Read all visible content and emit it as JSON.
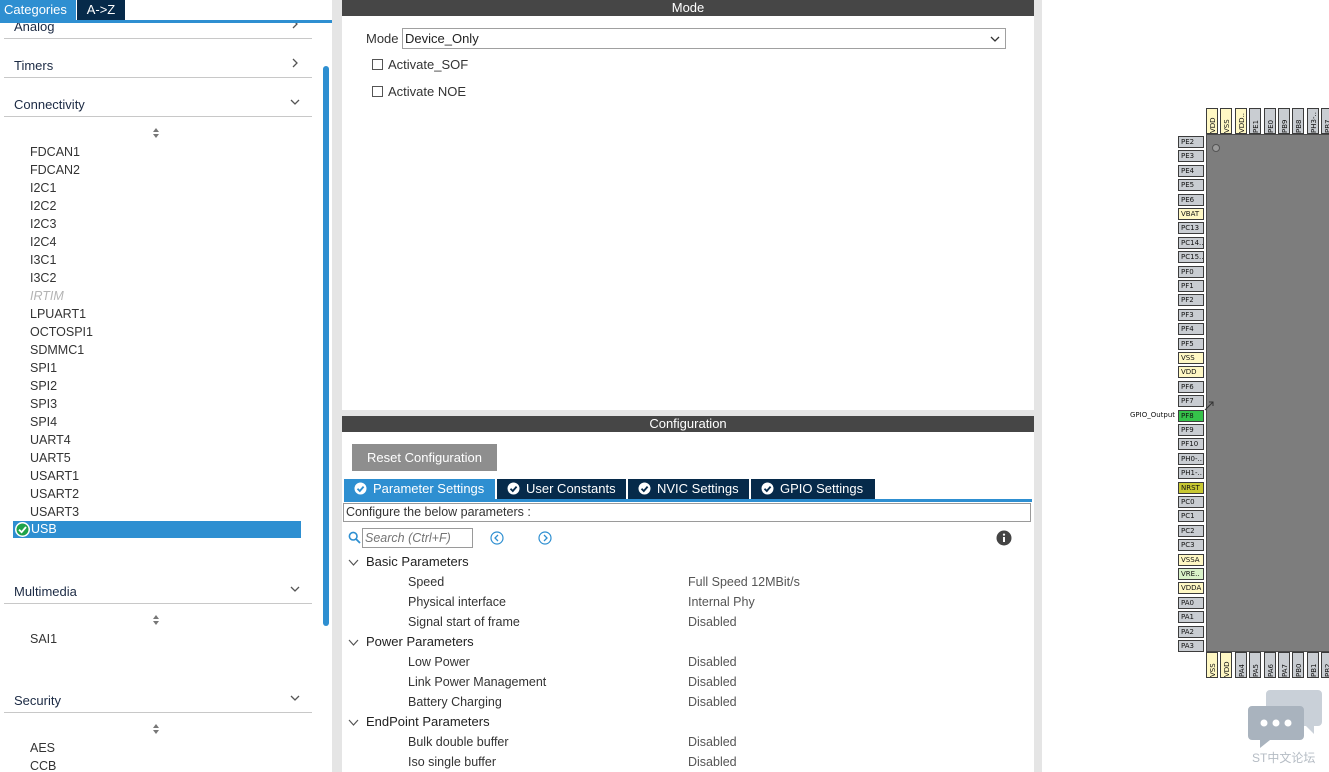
{
  "left": {
    "tabs": {
      "categories": "Categories",
      "az": "A->Z"
    },
    "categories": [
      {
        "name": "analog",
        "label": "Analog"
      },
      {
        "name": "timers",
        "label": "Timers"
      },
      {
        "name": "connectivity",
        "label": "Connectivity"
      },
      {
        "name": "multimedia",
        "label": "Multimedia"
      },
      {
        "name": "security",
        "label": "Security"
      }
    ],
    "connectivity_items": [
      "FDCAN1",
      "FDCAN2",
      "I2C1",
      "I2C2",
      "I2C3",
      "I2C4",
      "I3C1",
      "I3C2",
      "IRTIM",
      "LPUART1",
      "OCTOSPI1",
      "SDMMC1",
      "SPI1",
      "SPI2",
      "SPI3",
      "SPI4",
      "UART4",
      "UART5",
      "USART1",
      "USART2",
      "USART3"
    ],
    "disabled_items": [
      "IRTIM"
    ],
    "selected_item": "USB",
    "multimedia_items": [
      "SAI1"
    ],
    "security_items": [
      "AES",
      "CCB"
    ]
  },
  "mode": {
    "title": "Mode",
    "mode_label": "Mode",
    "mode_value": "Device_Only",
    "checkboxes": [
      {
        "label": "Activate_SOF",
        "checked": false
      },
      {
        "label": "Activate NOE",
        "checked": false
      }
    ]
  },
  "config": {
    "title": "Configuration",
    "reset_label": "Reset Configuration",
    "tabs": [
      {
        "label": "Parameter Settings",
        "active": true
      },
      {
        "label": "User Constants",
        "active": false
      },
      {
        "label": "NVIC Settings",
        "active": false
      },
      {
        "label": "GPIO Settings",
        "active": false
      }
    ],
    "description": "Configure the below parameters :",
    "search_placeholder": "Search (Ctrl+F)",
    "groups": [
      {
        "label": "Basic Parameters",
        "params": [
          {
            "name": "Speed",
            "value": "Full Speed 12MBit/s"
          },
          {
            "name": "Physical interface",
            "value": "Internal Phy"
          },
          {
            "name": "Signal start of frame",
            "value": "Disabled"
          }
        ]
      },
      {
        "label": "Power Parameters",
        "params": [
          {
            "name": "Low Power",
            "value": "Disabled"
          },
          {
            "name": "Link Power Management",
            "value": "Disabled"
          },
          {
            "name": "Battery Charging",
            "value": "Disabled"
          }
        ]
      },
      {
        "label": "EndPoint Parameters",
        "params": [
          {
            "name": "Bulk double buffer",
            "value": "Disabled"
          },
          {
            "name": "Iso single buffer",
            "value": "Disabled"
          }
        ]
      }
    ]
  },
  "chip": {
    "left_pins": [
      {
        "label": "PE2",
        "kind": "io"
      },
      {
        "label": "PE3",
        "kind": "io"
      },
      {
        "label": "PE4",
        "kind": "io"
      },
      {
        "label": "PE5",
        "kind": "io"
      },
      {
        "label": "PE6",
        "kind": "io"
      },
      {
        "label": "VBAT",
        "kind": "power"
      },
      {
        "label": "PC13",
        "kind": "io"
      },
      {
        "label": "PC14..",
        "kind": "io"
      },
      {
        "label": "PC15..",
        "kind": "io"
      },
      {
        "label": "PF0",
        "kind": "io"
      },
      {
        "label": "PF1",
        "kind": "io"
      },
      {
        "label": "PF2",
        "kind": "io"
      },
      {
        "label": "PF3",
        "kind": "io"
      },
      {
        "label": "PF4",
        "kind": "io"
      },
      {
        "label": "PF5",
        "kind": "io"
      },
      {
        "label": "VSS",
        "kind": "power"
      },
      {
        "label": "VDD",
        "kind": "power"
      },
      {
        "label": "PF6",
        "kind": "io"
      },
      {
        "label": "PF7",
        "kind": "io"
      },
      {
        "label": "PF8",
        "kind": "active"
      },
      {
        "label": "PF9",
        "kind": "io"
      },
      {
        "label": "PF10",
        "kind": "io"
      },
      {
        "label": "PH0-..",
        "kind": "io"
      },
      {
        "label": "PH1-..",
        "kind": "io"
      },
      {
        "label": "NRST",
        "kind": "reset"
      },
      {
        "label": "PC0",
        "kind": "io"
      },
      {
        "label": "PC1",
        "kind": "io"
      },
      {
        "label": "PC2",
        "kind": "io"
      },
      {
        "label": "PC3",
        "kind": "io"
      },
      {
        "label": "VSSA",
        "kind": "power"
      },
      {
        "label": "VRE..",
        "kind": "analog"
      },
      {
        "label": "VDDA",
        "kind": "power"
      },
      {
        "label": "PA0",
        "kind": "io"
      },
      {
        "label": "PA1",
        "kind": "io"
      },
      {
        "label": "PA2",
        "kind": "io"
      },
      {
        "label": "PA3",
        "kind": "io"
      }
    ],
    "top_pins": [
      {
        "label": "VDD",
        "kind": "power"
      },
      {
        "label": "VSS",
        "kind": "power"
      },
      {
        "label": "VDD..",
        "kind": "power"
      },
      {
        "label": "PE1",
        "kind": "io"
      },
      {
        "label": "PE0",
        "kind": "io"
      },
      {
        "label": "PB9",
        "kind": "io"
      },
      {
        "label": "PB8",
        "kind": "io"
      },
      {
        "label": "PH3-..",
        "kind": "io"
      },
      {
        "label": "PB7",
        "kind": "io"
      }
    ],
    "bottom_pins": [
      {
        "label": "VSS",
        "kind": "power"
      },
      {
        "label": "VDD",
        "kind": "power"
      },
      {
        "label": "PA4",
        "kind": "io"
      },
      {
        "label": "PA5",
        "kind": "io"
      },
      {
        "label": "PA6",
        "kind": "io"
      },
      {
        "label": "PA7",
        "kind": "io"
      },
      {
        "label": "PB0",
        "kind": "io"
      },
      {
        "label": "PB1",
        "kind": "io"
      },
      {
        "label": "PB2",
        "kind": "io"
      }
    ],
    "gpio_label": "GPIO_Output",
    "colors": {
      "io": "#c9cdd2",
      "power": "#fff8c4",
      "active": "#35c24a",
      "reset": "#c8c832",
      "analog": "#d8f2c8"
    }
  },
  "watermark": {
    "text": "ST中文论坛"
  },
  "theme": {
    "accent": "#2e8fd1",
    "dark_tab": "#062a4a",
    "panel_header": "#464646"
  }
}
